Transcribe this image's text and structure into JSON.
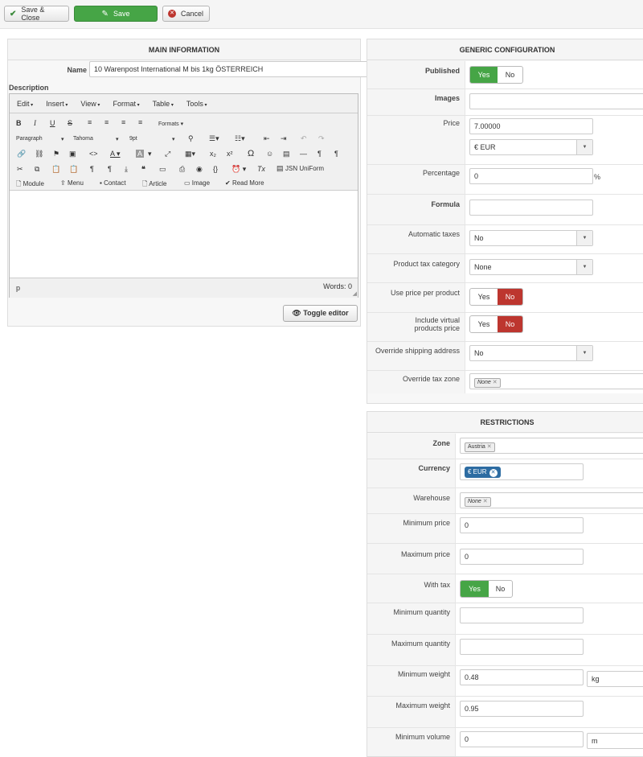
{
  "toolbar": {
    "save_close": "Save & Close",
    "save": "Save",
    "cancel": "Cancel"
  },
  "main_info": {
    "title": "MAIN INFORMATION",
    "name_label": "Name",
    "name_value": "10 Warenpost International M bis 1kg ÖSTERREICH",
    "description_label": "Description"
  },
  "editor": {
    "menus": [
      "Edit",
      "Insert",
      "View",
      "Format",
      "Table",
      "Tools"
    ],
    "formats": "Formats",
    "paragraph": "Paragraph",
    "font": "Tahoma",
    "size": "9pt",
    "jsn": "JSN UniForm",
    "module": "Module",
    "menu": "Menu",
    "contact": "Contact",
    "article": "Article",
    "image": "Image",
    "readmore": "Read More",
    "status_path": "p",
    "words": "Words: 0",
    "toggle_editor": "Toggle editor"
  },
  "generic": {
    "title": "GENERIC CONFIGURATION",
    "published": "Published",
    "yes": "Yes",
    "no": "No",
    "images": "Images",
    "price": "Price",
    "price_value": "7.00000",
    "currency_value": "€ EUR",
    "percentage": "Percentage",
    "percentage_value": "0",
    "percent_sign": "%",
    "formula": "Formula",
    "automatic_taxes": "Automatic taxes",
    "automatic_taxes_value": "No",
    "product_tax_category": "Product tax category",
    "product_tax_category_value": "None",
    "use_price_per_product": "Use price per product",
    "include_virtual_l1": "Include virtual",
    "include_virtual_l2": "products price",
    "override_shipping": "Override shipping address",
    "override_shipping_value": "No",
    "override_tax_zone": "Override tax zone",
    "none_chip": "None"
  },
  "restrictions": {
    "title": "RESTRICTIONS",
    "zone": "Zone",
    "zone_chip": "Austria",
    "currency": "Currency",
    "currency_chip": "€ EUR",
    "warehouse": "Warehouse",
    "warehouse_chip": "None",
    "min_price": "Minimum price",
    "min_price_value": "0",
    "max_price": "Maximum price",
    "max_price_value": "0",
    "with_tax": "With tax",
    "min_qty": "Minimum quantity",
    "max_qty": "Maximum quantity",
    "min_weight": "Minimum weight",
    "min_weight_value": "0.48",
    "weight_unit": "kg",
    "max_weight": "Maximum weight",
    "max_weight_value": "0.95",
    "min_volume": "Minimum volume",
    "min_volume_value": "0",
    "volume_unit": "m"
  }
}
